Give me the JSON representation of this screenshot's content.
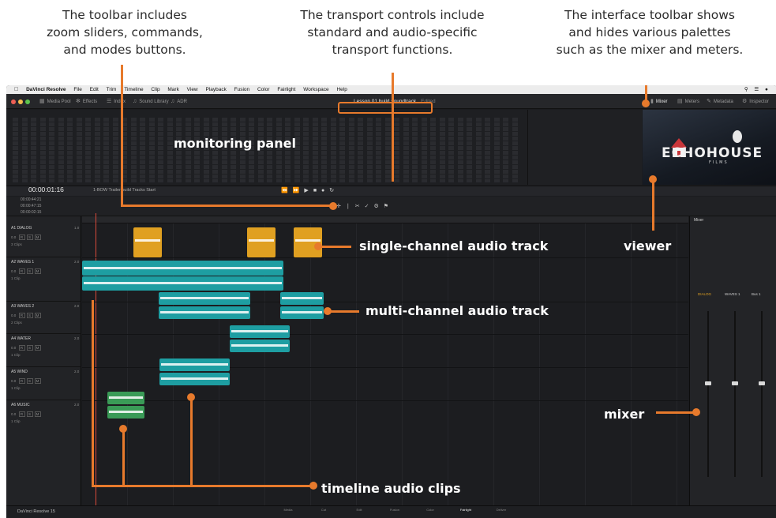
{
  "callouts": {
    "toolbar": "The toolbar includes\nzoom sliders, commands,\nand modes buttons.",
    "transport": "The transport controls include\nstandard and audio-specific\ntransport functions.",
    "interface": "The interface toolbar shows\nand hides various palettes\nsuch as the mixer and meters."
  },
  "annotations": {
    "monitoring_panel": "monitoring panel",
    "single_channel": "single-channel audio track",
    "viewer": "viewer",
    "multi_channel": "multi-channel audio track",
    "mixer": "mixer",
    "timeline_clips": "timeline audio clips"
  },
  "menubar": {
    "app_name": "DaVinci Resolve",
    "items": [
      "File",
      "Edit",
      "Trim",
      "Timeline",
      "Clip",
      "Mark",
      "View",
      "Playback",
      "Fusion",
      "Color",
      "Fairlight",
      "Workspace",
      "Help"
    ]
  },
  "toolbar": {
    "media_pool": "Media Pool",
    "effects": "Effects",
    "index": "Index",
    "sound_library": "Sound Library",
    "adr": "ADR",
    "project_title": "Lesson 01 build soundtrack",
    "edited": "Edited",
    "mixer": "Mixer",
    "meters": "Meters",
    "metadata": "Metadata",
    "inspector": "Inspector"
  },
  "transport": {
    "timecode": "00:00:01:16",
    "timeline_name": "1-BOW Trailer build Tracks Start"
  },
  "editbar": {
    "tc1": "00:00:44:21",
    "tc2": "00:00:47:15",
    "tc3": "00:00:02:15"
  },
  "tracks": [
    {
      "id": "A1",
      "name": "DIALOG",
      "channels": "1.0",
      "clips": "3 Clips"
    },
    {
      "id": "A2",
      "name": "WAVES 1",
      "channels": "2.0",
      "clips": "1 Clip"
    },
    {
      "id": "A3",
      "name": "WAVES 2",
      "channels": "2.0",
      "clips": "2 Clips"
    },
    {
      "id": "A4",
      "name": "WATER",
      "channels": "2.0",
      "clips": "1 Clip"
    },
    {
      "id": "A5",
      "name": "WIND",
      "channels": "2.0",
      "clips": "1 Clip"
    },
    {
      "id": "A6",
      "name": "MUSIC",
      "channels": "2.0",
      "clips": "1 Clip"
    }
  ],
  "viewer": {
    "logo": "ECHOHOUSE",
    "sub": "FILMS"
  },
  "mixer": {
    "title": "Mixer",
    "strips": [
      "DIALOG",
      "WAVES 1",
      "Bus 1"
    ]
  },
  "pagebar": {
    "brand": "DaVinci Resolve 15",
    "pages": [
      "Media",
      "Cut",
      "Edit",
      "Fusion",
      "Color",
      "Fairlight",
      "Deliver"
    ]
  },
  "colors": {
    "accent": "#e77a2c",
    "dialog_clip": "#e0a021",
    "effects_clip": "#1e9ea2",
    "music_clip": "#3a9b57"
  }
}
